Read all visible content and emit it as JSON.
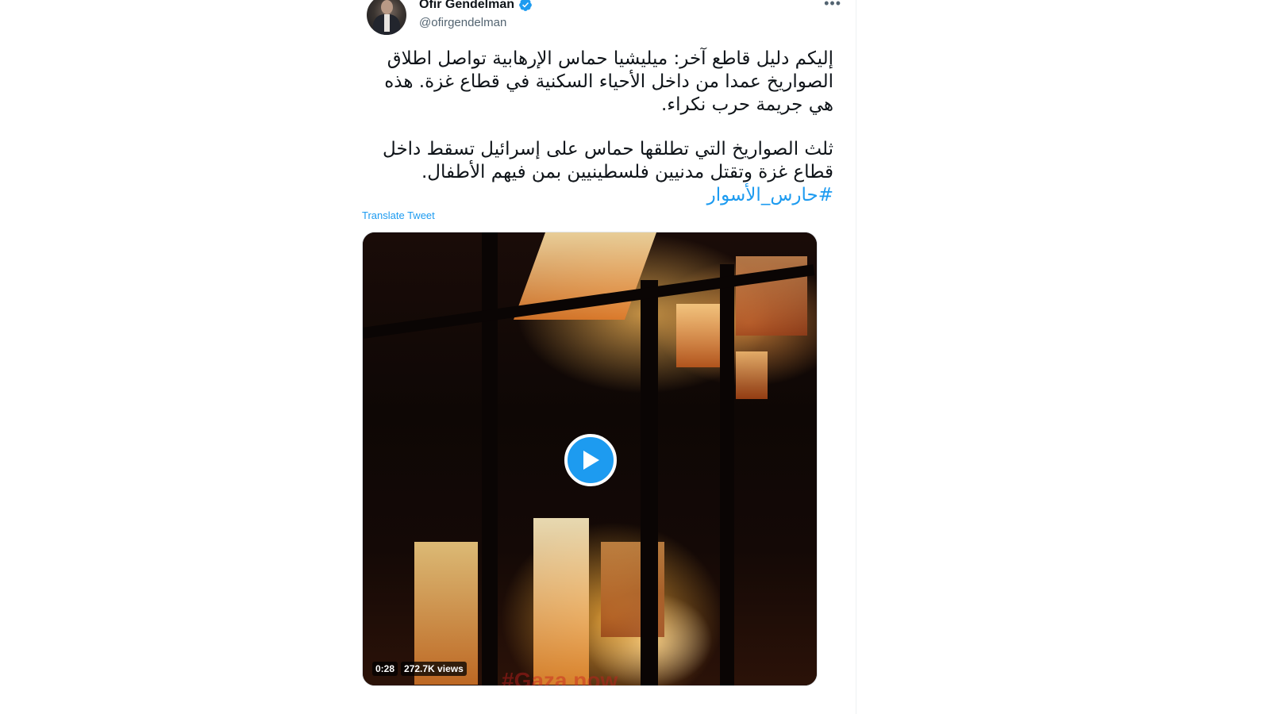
{
  "tweet": {
    "author": {
      "name": "Ofir Gendelman",
      "handle": "@ofirgendelman",
      "verified": true
    },
    "more_icon": "more-horizontal-icon",
    "paragraphs": [
      "إليكم دليل قاطع آخر: ميليشيا حماس الإرهابية تواصل اطلاق الصواريخ عمدا من داخل الأحياء السكنية في قطاع غزة. هذه هي جريمة حرب نكراء.",
      "ثلث الصواريخ التي تطلقها حماس على إسرائيل تسقط داخل قطاع غزة وتقتل مدنيين فلسطينيين بمن فيهم الأطفال."
    ],
    "hashtag": "#حارس_الأسوار",
    "translate_label": "Translate Tweet",
    "media": {
      "type": "video",
      "duration": "0:28",
      "views": "272.7K views",
      "watermark": "#Gaza now",
      "play_icon": "play-icon"
    }
  },
  "colors": {
    "accent": "#1d9bf0",
    "text": "#0f1419",
    "secondary_text": "#536471"
  }
}
